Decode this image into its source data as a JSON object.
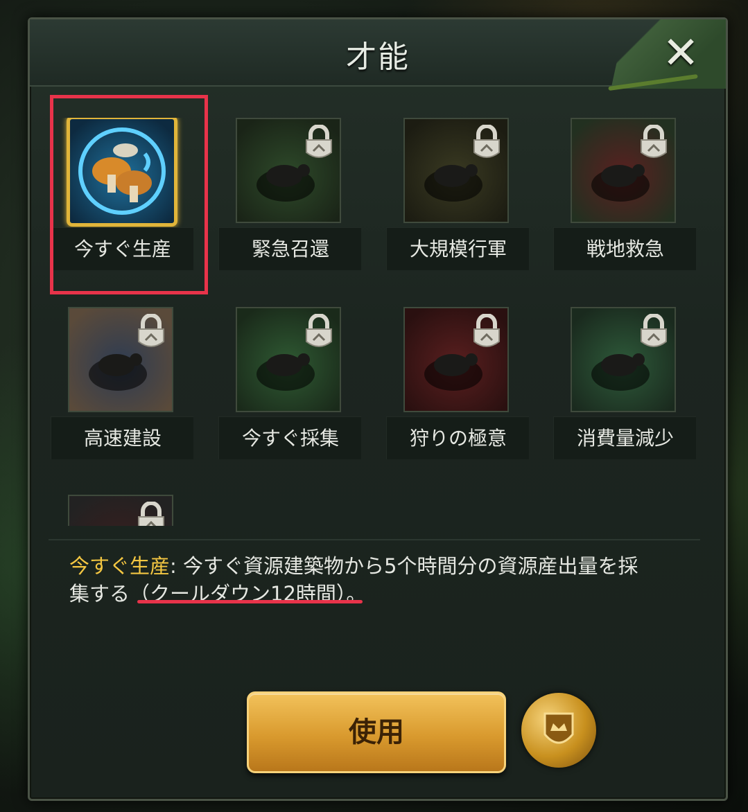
{
  "window": {
    "title": "才能"
  },
  "talents": [
    {
      "label": "今すぐ生産",
      "locked": false,
      "active": true,
      "icon": "mushroom-compass-icon"
    },
    {
      "label": "緊急召還",
      "locked": true,
      "icon": "beetle-return-icon"
    },
    {
      "label": "大規模行軍",
      "locked": true,
      "icon": "ant-march-icon"
    },
    {
      "label": "戦地救急",
      "locked": true,
      "icon": "beetle-heal-icon"
    },
    {
      "label": "高速建設",
      "locked": true,
      "icon": "ant-build-icon"
    },
    {
      "label": "今すぐ採集",
      "locked": true,
      "icon": "ant-gather-icon"
    },
    {
      "label": "狩りの極意",
      "locked": true,
      "icon": "beetle-hunt-icon"
    },
    {
      "label": "消費量減少",
      "locked": true,
      "icon": "mushroom-reduce-icon"
    },
    {
      "label": "",
      "locked": true,
      "icon": "pyramid-icon"
    }
  ],
  "description": {
    "name": "今すぐ生産",
    "text_a": ": 今すぐ資源建築物から5个時間分の資源産出量を採",
    "text_b": "集する（クールダウン12時間）。"
  },
  "use_button": {
    "label": "使用"
  },
  "colors": {
    "accent": "#e1b53a",
    "highlight": "#e8334a",
    "name_text": "#f4c742"
  }
}
